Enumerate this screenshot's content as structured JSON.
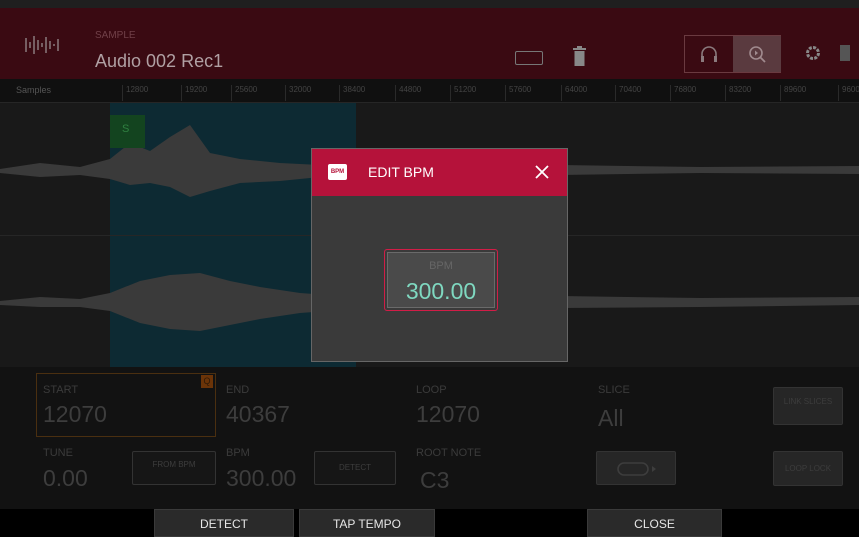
{
  "header": {
    "small_label": "SAMPLE",
    "title": "Audio 002 Rec1",
    "icons": [
      "waveform-icon",
      "keyboard-icon",
      "trash-icon",
      "headphones-icon",
      "zoom-icon",
      "gear-icon",
      "battery-icon"
    ]
  },
  "ruler": {
    "label": "Samples",
    "ticks": [
      "12800",
      "19200",
      "25600",
      "32000",
      "38400",
      "44800",
      "51200",
      "57600",
      "64000",
      "70400",
      "76800",
      "83200",
      "89600",
      "9600"
    ]
  },
  "waveform": {
    "marker": "S"
  },
  "params": {
    "start_label": "START",
    "start_value": "12070",
    "q_badge": "Q",
    "end_label": "END",
    "end_value": "40367",
    "loop_label": "LOOP",
    "loop_value": "12070",
    "slice_label": "SLICE",
    "slice_value": "All",
    "link_slices": "LINK SLICES",
    "tune_label": "TUNE",
    "tune_value": "0.00",
    "from_bpm": "FROM BPM",
    "bpm_label": "BPM",
    "bpm_value": "300.00",
    "detect": "DETECT",
    "root_note_label": "ROOT NOTE",
    "root_note_value": "C3",
    "loop_lock": "LOOP LOCK"
  },
  "bottom_bar": {
    "detect": "DETECT",
    "tap_tempo": "TAP TEMPO",
    "close": "CLOSE"
  },
  "modal": {
    "badge": "BPM",
    "title": "EDIT BPM",
    "field_label": "BPM",
    "field_value": "300.00"
  },
  "colors": {
    "accent": "#b5123a",
    "value": "#7fd8c0",
    "field_border": "#d11d47"
  }
}
